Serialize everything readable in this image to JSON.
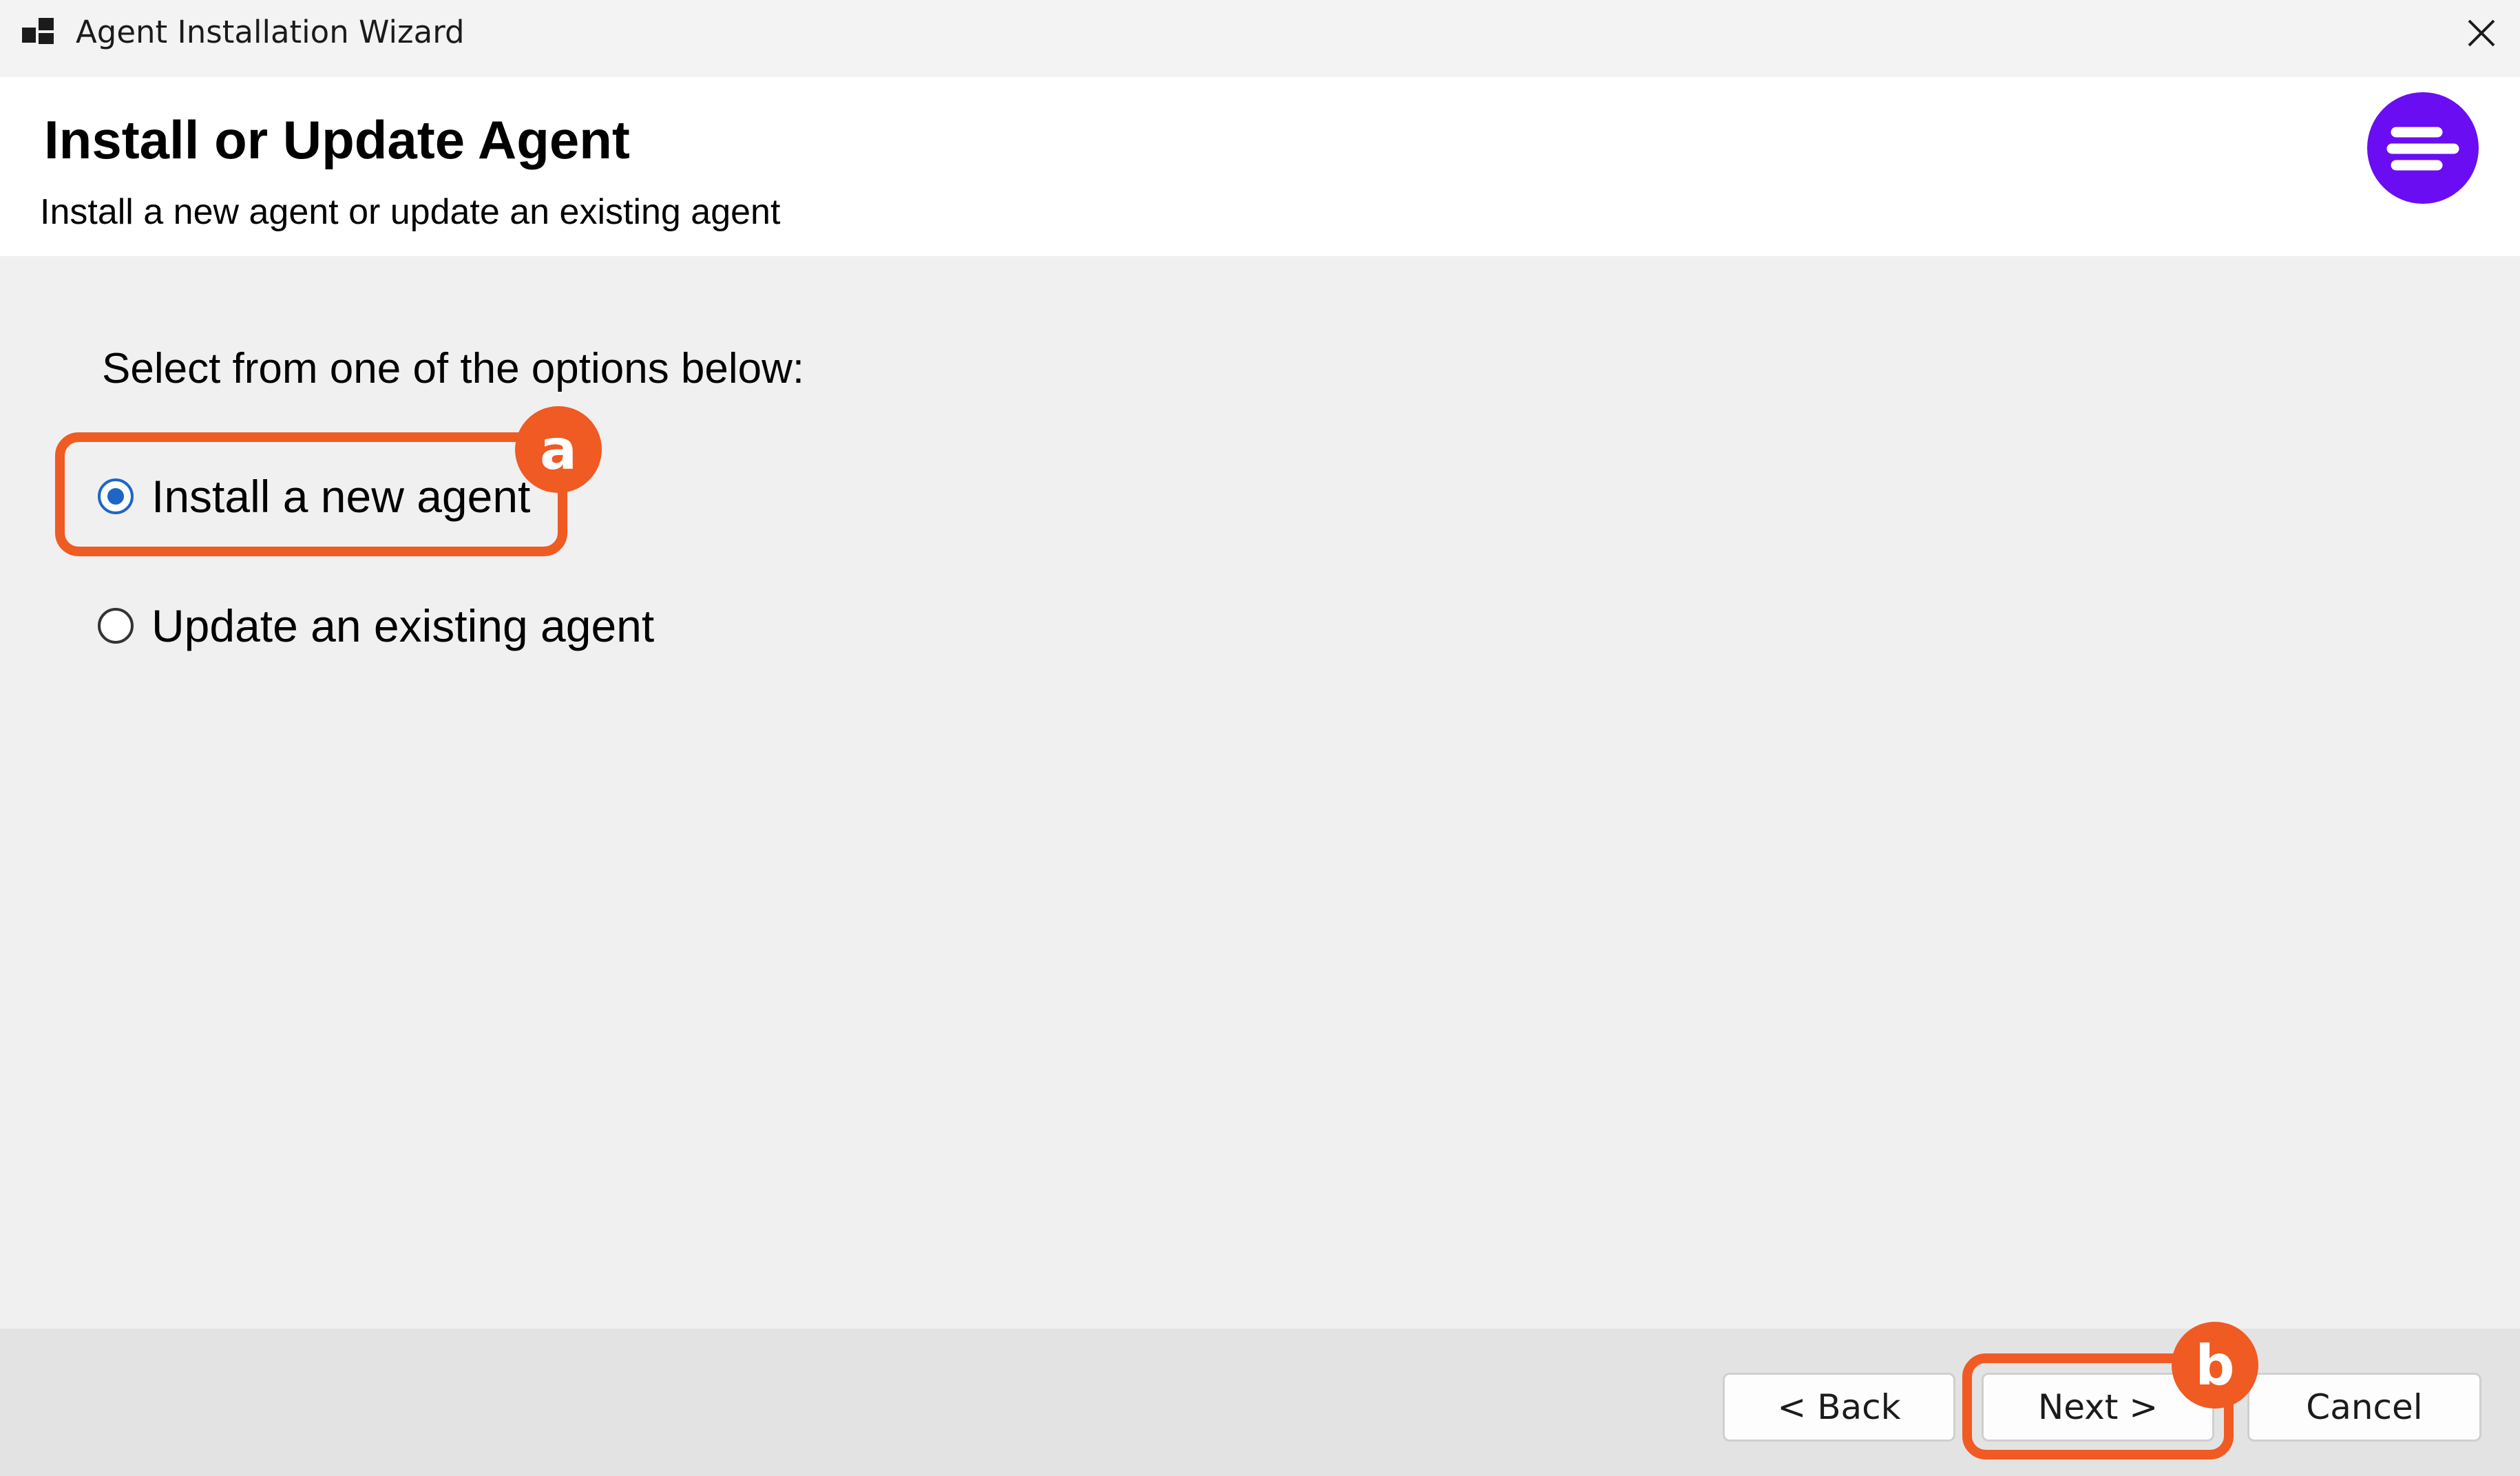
{
  "window": {
    "title": "Agent Installation Wizard",
    "icon": "app-window-icon",
    "close_icon": "close-icon"
  },
  "header": {
    "title": "Install or Update Agent",
    "subtitle": "Install a new agent or update an existing agent",
    "logo": "brand-logo",
    "logo_color": "#6a0df2"
  },
  "main": {
    "prompt": "Select from one of the options below:",
    "options": [
      {
        "label": "Install a new agent",
        "selected": true
      },
      {
        "label": "Update an existing agent",
        "selected": false
      }
    ]
  },
  "buttons": {
    "back": "< Back",
    "next": "Next >",
    "cancel": "Cancel"
  },
  "annotations": {
    "a": "a",
    "b": "b",
    "color": "#f05a23"
  }
}
